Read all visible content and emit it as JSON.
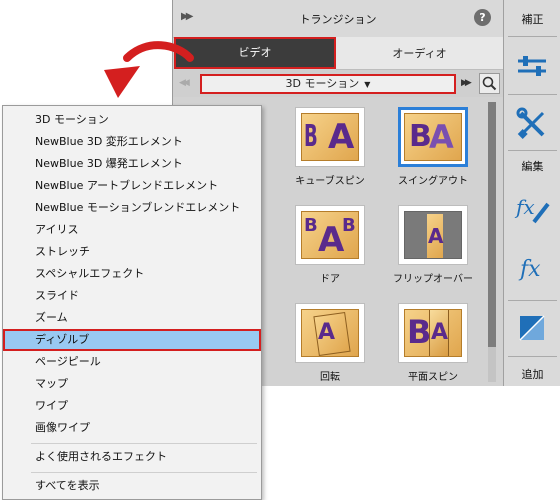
{
  "panel": {
    "title": "トランジション",
    "help_label": "?",
    "tabs": {
      "video": "ビデオ",
      "audio": "オーディオ"
    },
    "category": "3D モーション"
  },
  "transitions": [
    {
      "label": "キューブスピン",
      "selected": false
    },
    {
      "label": "スイングアウト",
      "selected": true
    },
    {
      "label": "ドア",
      "selected": false
    },
    {
      "label": "フリップオーバー",
      "selected": false
    },
    {
      "label": "回転",
      "selected": false
    },
    {
      "label": "平面スピン",
      "selected": false
    }
  ],
  "sidebar": {
    "adjust_label": "補正",
    "edit_label": "編集",
    "add_label": "追加"
  },
  "dropdown": {
    "items": [
      "3D モーション",
      "NewBlue 3D 変形エレメント",
      "NewBlue 3D 爆発エレメント",
      "NewBlue アートブレンドエレメント",
      "NewBlue モーションブレンドエレメント",
      "アイリス",
      "ストレッチ",
      "スペシャルエフェクト",
      "スライド",
      "ズーム",
      "ディゾルブ",
      "ページピール",
      "マップ",
      "ワイプ",
      "画像ワイプ"
    ],
    "highlighted": "ディゾルブ",
    "extra_items": [
      "よく使用されるエフェクト",
      "すべてを表示"
    ]
  },
  "colors": {
    "highlight_border": "#d41f1f",
    "highlight_fill": "#99c9f2",
    "accent_blue": "#2b7fd8"
  }
}
